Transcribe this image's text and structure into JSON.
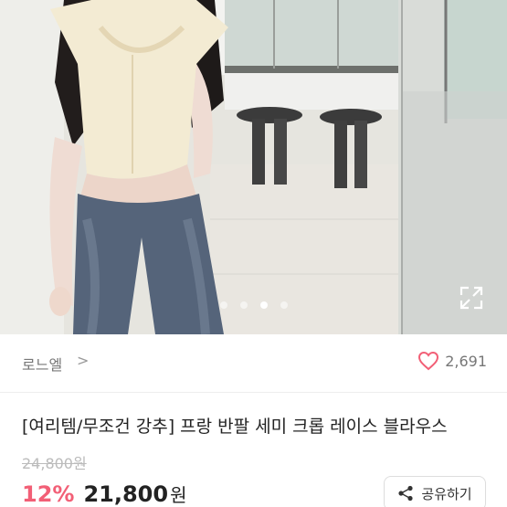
{
  "gallery": {
    "image_alt": "product-photo",
    "dots": 4,
    "active_index": 2
  },
  "seller": {
    "name": "로느엘",
    "chevron": ">"
  },
  "likes": {
    "count": "2,691",
    "icon": "heart-outline-icon",
    "color": "#f25f76"
  },
  "product": {
    "title": "[여리템/무조건 강추] 프랑 반팔 세미 크롭 레이스 블라우스",
    "original_price": "24,800원",
    "discount": "12%",
    "price": "21,800",
    "currency": "원"
  },
  "share": {
    "label": "공유하기",
    "icon": "share-icon"
  }
}
